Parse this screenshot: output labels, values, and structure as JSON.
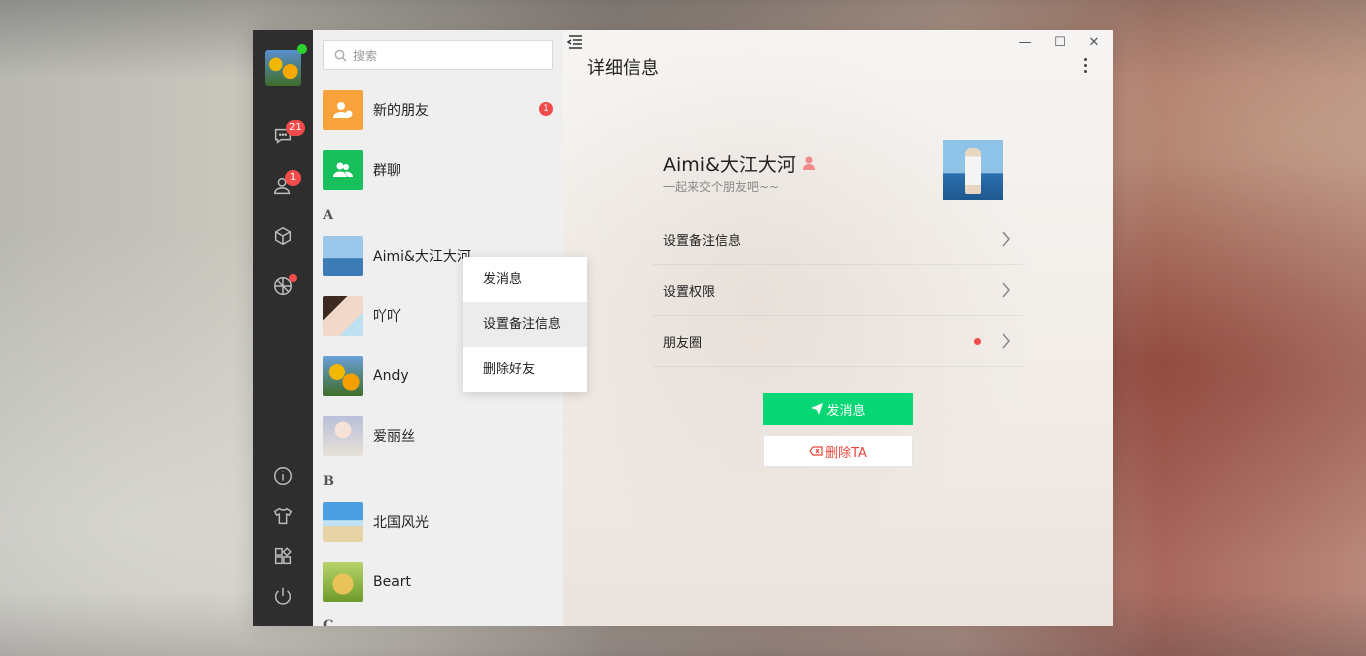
{
  "window": {
    "min_icon": "minimize-icon",
    "max_icon": "maximize-icon",
    "close_icon": "close-icon"
  },
  "sidebar": {
    "badges": {
      "chat": "21",
      "contacts": "1"
    },
    "icons": [
      "chat-icon",
      "contacts-icon",
      "cube-icon",
      "moments-icon",
      "info-icon",
      "shirt-icon",
      "apps-icon",
      "power-icon"
    ]
  },
  "search": {
    "placeholder": "搜索"
  },
  "contacts": {
    "new_friends": {
      "label": "新的朋友",
      "badge": "1"
    },
    "group_chat": {
      "label": "群聊"
    },
    "letter_a": "A",
    "letter_b": "B",
    "letter_c": "C",
    "items": [
      {
        "name": "Aimi&大江大河"
      },
      {
        "name": "吖吖"
      },
      {
        "name": "Andy"
      },
      {
        "name": "爱丽丝"
      },
      {
        "name": "北国风光"
      },
      {
        "name": "Beart"
      }
    ]
  },
  "context_menu": {
    "items": [
      "发消息",
      "设置备注信息",
      "删除好友"
    ]
  },
  "detail": {
    "title": "详细信息",
    "name": "Aimi&大江大河",
    "signature": "一起来交个朋友吧~~",
    "rows": [
      "设置备注信息",
      "设置权限",
      "朋友圈"
    ],
    "send_button": "发消息",
    "delete_button": "删除TA"
  },
  "colors": {
    "accent_green": "#08d775",
    "badge_red": "#f24b4b",
    "delete_red": "#e5473b",
    "sidebar_dark": "#2e2e2e"
  }
}
